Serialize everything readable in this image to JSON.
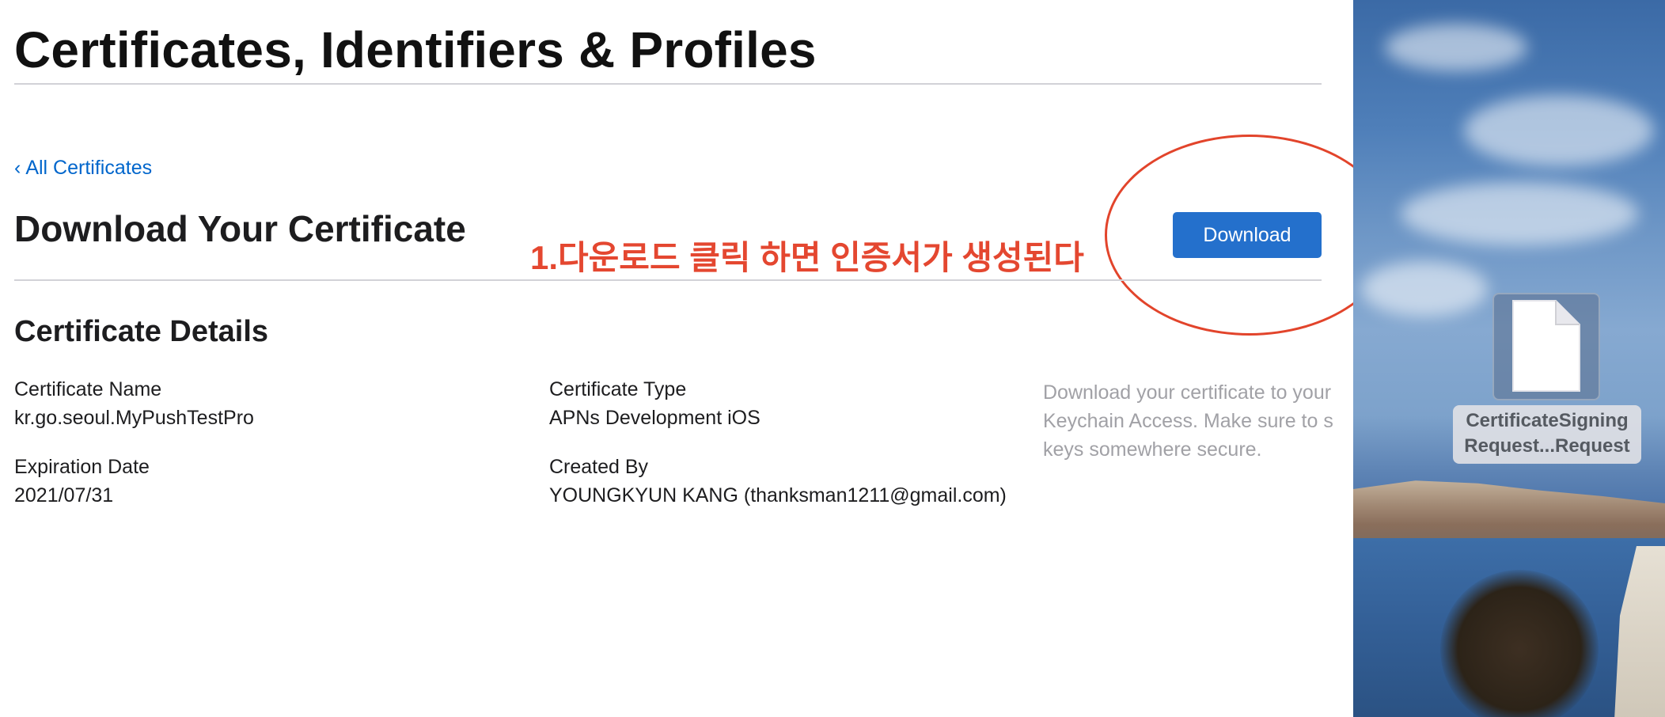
{
  "page": {
    "title": "Certificates, Identifiers & Profiles",
    "back_link": {
      "chevron": "‹",
      "label": "All Certificates"
    },
    "section_title": "Download Your Certificate",
    "download_label": "Download",
    "annotation": "1.다운로드 클릭 하면 인증서가 생성된다",
    "details_title": "Certificate Details",
    "details": {
      "certificate_name": {
        "label": "Certificate Name",
        "value": "kr.go.seoul.MyPushTestPro"
      },
      "certificate_type": {
        "label": "Certificate Type",
        "value": "APNs Development iOS"
      },
      "expiration_date": {
        "label": "Expiration Date",
        "value": "2021/07/31"
      },
      "created_by": {
        "label": "Created By",
        "value": "YOUNGKYUN KANG (thanksman1211@gmail.com)"
      }
    },
    "side_note_lines": [
      "Download your certificate to your",
      "Keychain Access. Make sure to s",
      "keys somewhere secure."
    ]
  },
  "desktop": {
    "file": {
      "icon": "document-icon",
      "caption_lines": [
        "CertificateSigning",
        "Request...Request"
      ]
    }
  },
  "colors": {
    "link": "#0066cc",
    "button": "#2470cc",
    "annotation": "#e44730",
    "note_text": "#a1a1a6"
  }
}
